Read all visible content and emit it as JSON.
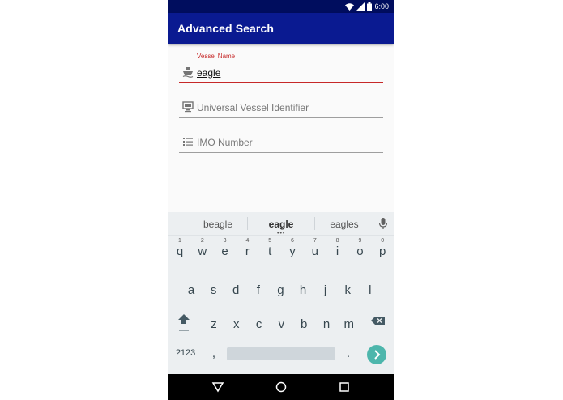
{
  "status_bar": {
    "time": "6:00"
  },
  "app_bar": {
    "title": "Advanced Search"
  },
  "form": {
    "vessel_name": {
      "label": "Vessel Name",
      "value": "eagle"
    },
    "uvi": {
      "placeholder": "Universal Vessel Identifier"
    },
    "imo": {
      "placeholder": "IMO Number"
    }
  },
  "keyboard": {
    "suggestions": [
      "beagle",
      "eagle",
      "eagles"
    ],
    "row1": [
      "q",
      "w",
      "e",
      "r",
      "t",
      "y",
      "u",
      "i",
      "o",
      "p"
    ],
    "row1_hints": [
      "1",
      "2",
      "3",
      "4",
      "5",
      "6",
      "7",
      "8",
      "9",
      "0"
    ],
    "row2": [
      "a",
      "s",
      "d",
      "f",
      "g",
      "h",
      "j",
      "k",
      "l"
    ],
    "row3": [
      "z",
      "x",
      "c",
      "v",
      "b",
      "n",
      "m"
    ],
    "symbols_label": "?123",
    "comma": ",",
    "period": "."
  },
  "colors": {
    "primary": "#0a1a91",
    "status": "#000d5e",
    "accent": "#c62828",
    "go": "#4db6ac"
  }
}
